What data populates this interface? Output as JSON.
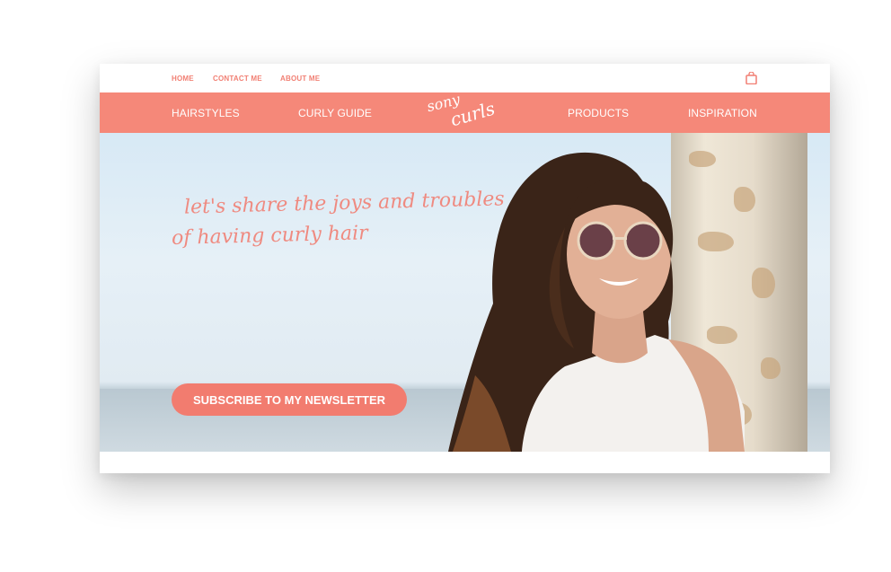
{
  "topbar": {
    "links": [
      "HOME",
      "CONTACT ME",
      "ABOUT ME"
    ]
  },
  "navbar": {
    "left_items": [
      "HAIRSTYLES",
      "CURLY GUIDE"
    ],
    "right_items": [
      "PRODUCTS",
      "INSPIRATION"
    ],
    "logo_line1": "sony",
    "logo_line2": "curls"
  },
  "hero": {
    "tagline_line1": "let's share the joys and troubles",
    "tagline_line2": "of having curly hair",
    "cta_label": "SUBSCRIBE TO MY NEWSLETTER"
  },
  "colors": {
    "accent": "#f58879",
    "link": "#f17f73",
    "button": "#f27c6f"
  },
  "icons": {
    "cart": "shopping-bag-icon"
  }
}
